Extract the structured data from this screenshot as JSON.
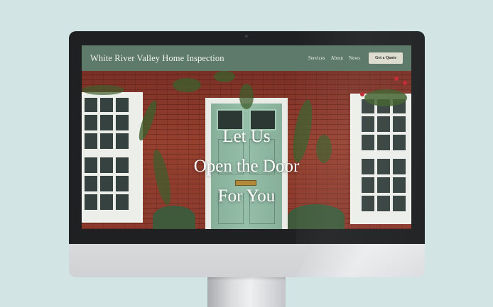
{
  "site": {
    "brand": "White River Valley Home Inspection",
    "nav": [
      "Services",
      "About",
      "News"
    ],
    "cta": "Get a Quote"
  },
  "hero": {
    "headline_lines": [
      "Let Us",
      "Open the Door",
      "For You"
    ]
  },
  "colors": {
    "background": "#d3e4e4",
    "navbar": "#5d7a6b",
    "cta_button": "#dedccf",
    "door": "#8fbaa3",
    "brick": "#8e3b2d"
  }
}
